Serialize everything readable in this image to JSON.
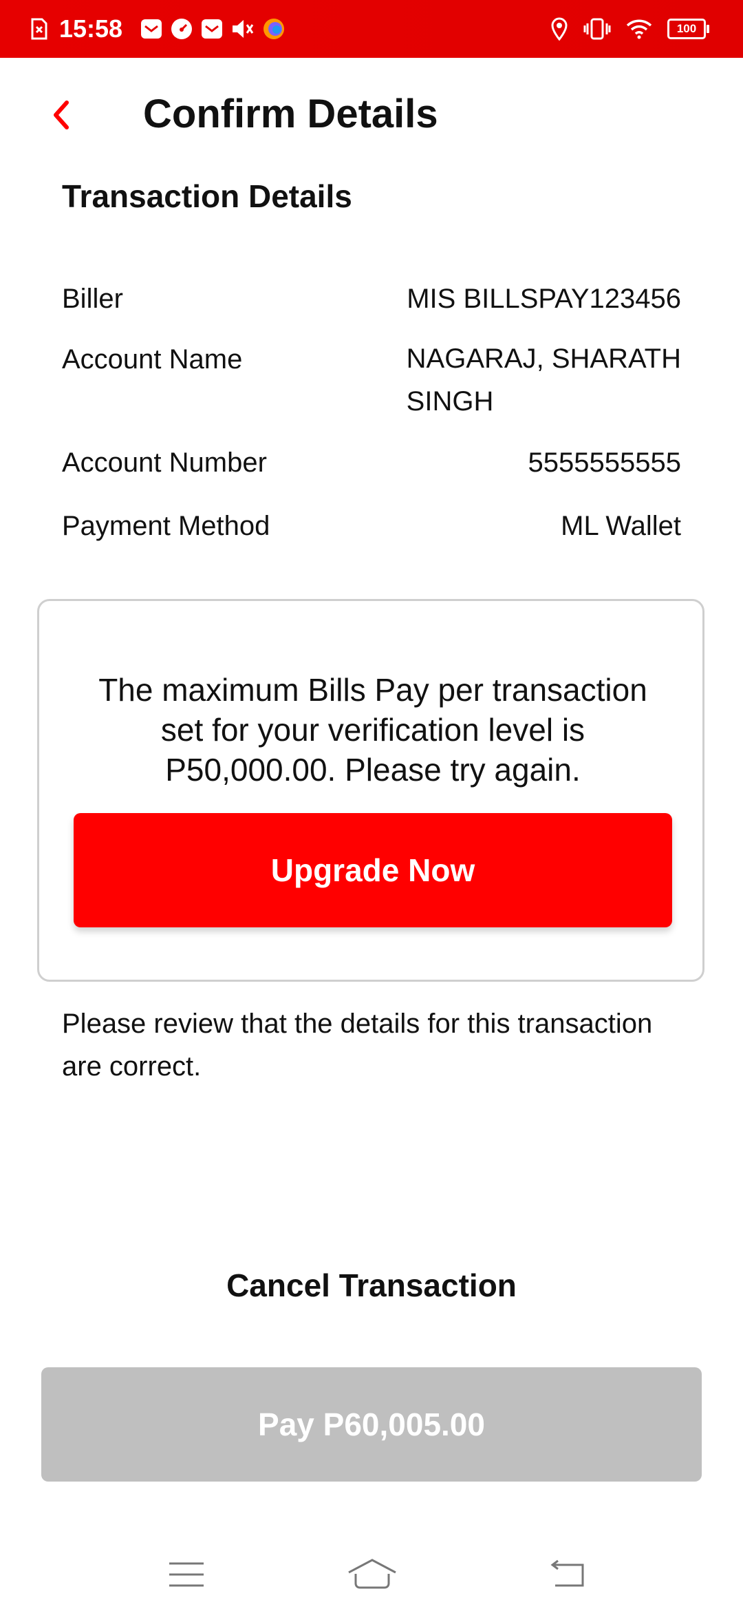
{
  "status_bar": {
    "time": "15:58",
    "battery": "100",
    "left_icons": [
      "sim-error-icon",
      "mail-icon",
      "speedometer-icon",
      "mail-icon",
      "mute-icon",
      "browser-icon"
    ],
    "right_icons": [
      "location-icon",
      "vibrate-icon",
      "wifi-icon",
      "battery-icon"
    ]
  },
  "header": {
    "title": "Confirm Details",
    "back_icon": "chevron-left-icon"
  },
  "transaction": {
    "section_title": "Transaction Details",
    "rows": [
      {
        "label": "Biller",
        "value": "MIS BILLSPAY123456"
      },
      {
        "label": "Account Name",
        "value_line1": "NAGARAJ, SHARATH",
        "value_line2": "SINGH"
      },
      {
        "label": "Account Number",
        "value": "5555555555"
      },
      {
        "label": "Payment Method",
        "value": "ML Wallet"
      }
    ]
  },
  "limit_card": {
    "message": "The maximum Bills Pay per transaction set for your verification level is P50,000.00. Please try again.",
    "button_label": "Upgrade Now"
  },
  "review_text": "Please review that the details for this transaction are correct.",
  "actions": {
    "cancel_label": "Cancel Transaction",
    "pay_label": "Pay P60,005.00"
  },
  "colors": {
    "brand_red": "#ff0000",
    "status_bar_red": "#e60000",
    "disabled_gray": "#bfbfbf"
  },
  "nav_bar": {
    "icons": [
      "menu-icon",
      "home-icon",
      "back-icon"
    ]
  }
}
